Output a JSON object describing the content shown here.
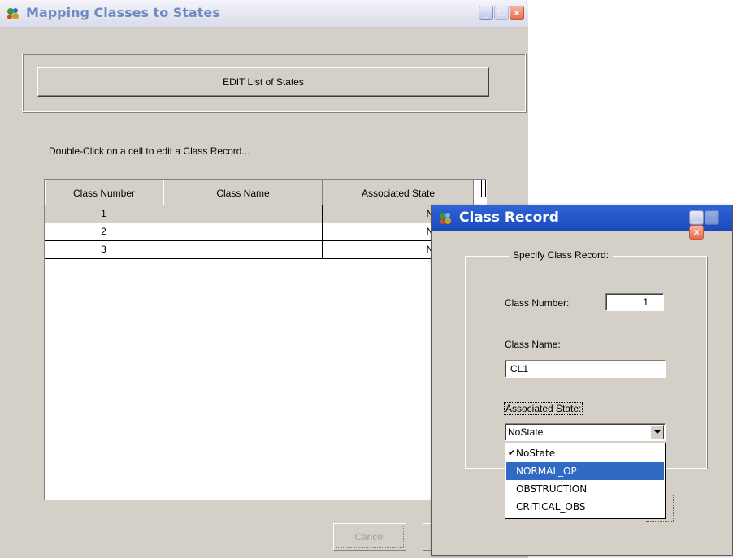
{
  "main_window": {
    "title": "Mapping Classes to States",
    "edit_button": "EDIT List of States",
    "hint": "Double-Click on a cell to edit a Class Record...",
    "table": {
      "columns": [
        "Class Number",
        "Class Name",
        "Associated State"
      ],
      "rows": [
        {
          "number": "1",
          "name": "",
          "state": "NoState"
        },
        {
          "number": "2",
          "name": "",
          "state": "NoState"
        },
        {
          "number": "3",
          "name": "",
          "state": "NoState"
        }
      ]
    },
    "cancel_button": "Cancel",
    "ok_button": ""
  },
  "dialog": {
    "title": "Class Record",
    "group_caption": "Specify Class Record:",
    "class_number_label": "Class Number:",
    "class_number_value": "1",
    "class_name_label": "Class Name:",
    "class_name_value": "CL1",
    "associated_state_label": "Associated State:",
    "combo_value": "NoState",
    "options": [
      {
        "label": "NoState",
        "checked": true,
        "highlighted": false
      },
      {
        "label": "NORMAL_OP",
        "checked": false,
        "highlighted": true
      },
      {
        "label": "OBSTRUCTION",
        "checked": false,
        "highlighted": false
      },
      {
        "label": "CRITICAL_OBS",
        "checked": false,
        "highlighted": false
      }
    ]
  },
  "colors": {
    "dialog_titlebar": "#2f64d8",
    "highlight": "#316ac5",
    "window_face": "#d4d0c8"
  }
}
